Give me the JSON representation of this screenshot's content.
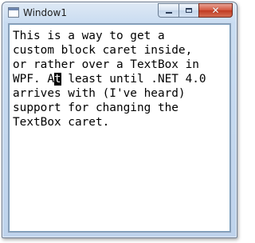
{
  "window": {
    "title": "Window1",
    "minimize_icon": "minimize-icon",
    "maximize_icon": "maximize-icon",
    "close_icon": "close-icon",
    "close_glyph": "✕"
  },
  "textbox": {
    "lines": [
      "This is a way to get a",
      "custom block caret inside,",
      "or rather over a TextBox in"
    ],
    "line4_before_caret": "WPF. A",
    "caret_char": "t",
    "line4_after_caret": " least until .NET 4.0",
    "lines_after": [
      "arrives with (I've heard)",
      "support for changing the",
      "TextBox caret."
    ]
  },
  "colors": {
    "caret_background": "#000000",
    "caret_foreground": "#ffffff",
    "close_button": "#c03a21"
  }
}
